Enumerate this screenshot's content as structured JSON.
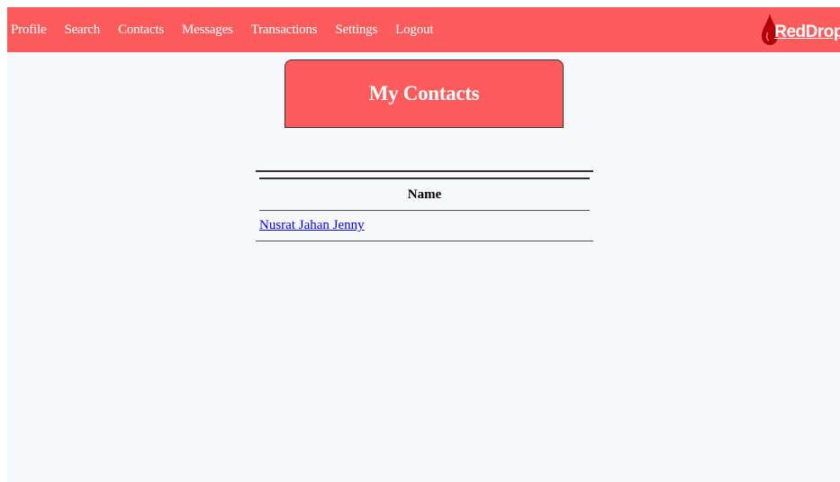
{
  "navbar": {
    "links": [
      "Profile",
      "Search",
      "Contacts",
      "Messages",
      "Transactions",
      "Settings",
      "Logout"
    ],
    "logo_text": "RedDrop",
    "color": "#fe5c5c"
  },
  "page": {
    "title": "My Contacts"
  },
  "contacts_table": {
    "header": "Name",
    "rows": [
      "Nusrat Jahan Jenny"
    ]
  },
  "colors": {
    "accent": "#fe5c5c",
    "link": "#0000ee",
    "background": "#f7f8fc"
  }
}
